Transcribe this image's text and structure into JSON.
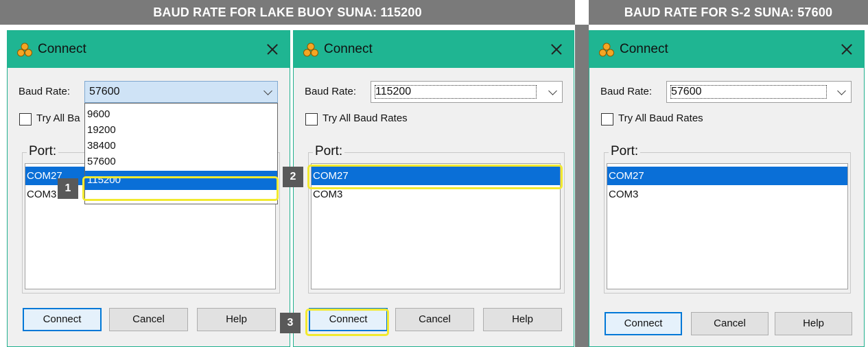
{
  "banners": {
    "left": "BAUD RATE FOR LAKE BUOY SUNA: 115200",
    "right": "BAUD RATE FOR S-2 SUNA: 57600"
  },
  "colors": {
    "titlebar": "#1fb592",
    "selection": "#0a6fd7",
    "highlight": "#f2ea2f",
    "banner": "#7a7a7a"
  },
  "dialogs": [
    {
      "title": "Connect",
      "baud_label": "Baud Rate:",
      "baud_value": "57600",
      "try_all": "Try All Ba",
      "port_label": "Port:",
      "ports": [
        "COM27",
        "COM3"
      ],
      "selected_port": "COM27",
      "dropdown_options": [
        "9600",
        "19200",
        "38400",
        "57600",
        "115200"
      ],
      "dropdown_selected": "115200",
      "buttons": {
        "connect": "Connect",
        "cancel": "Cancel",
        "help": "Help"
      }
    },
    {
      "title": "Connect",
      "baud_label": "Baud Rate:",
      "baud_value": "115200",
      "try_all": "Try All Baud Rates",
      "port_label": "Port:",
      "ports": [
        "COM27",
        "COM3"
      ],
      "selected_port": "COM27",
      "buttons": {
        "connect": "Connect",
        "cancel": "Cancel",
        "help": "Help"
      }
    },
    {
      "title": "Connect",
      "baud_label": "Baud Rate:",
      "baud_value": "57600",
      "try_all": "Try All Baud Rates",
      "port_label": "Port:",
      "ports": [
        "COM27",
        "COM3"
      ],
      "selected_port": "COM27",
      "buttons": {
        "connect": "Connect",
        "cancel": "Cancel",
        "help": "Help"
      }
    }
  ],
  "steps": [
    "1",
    "2",
    "3"
  ],
  "icons": {
    "app": "app-logo-icon",
    "close": "close-icon",
    "dropdown": "chevron-down-icon"
  }
}
